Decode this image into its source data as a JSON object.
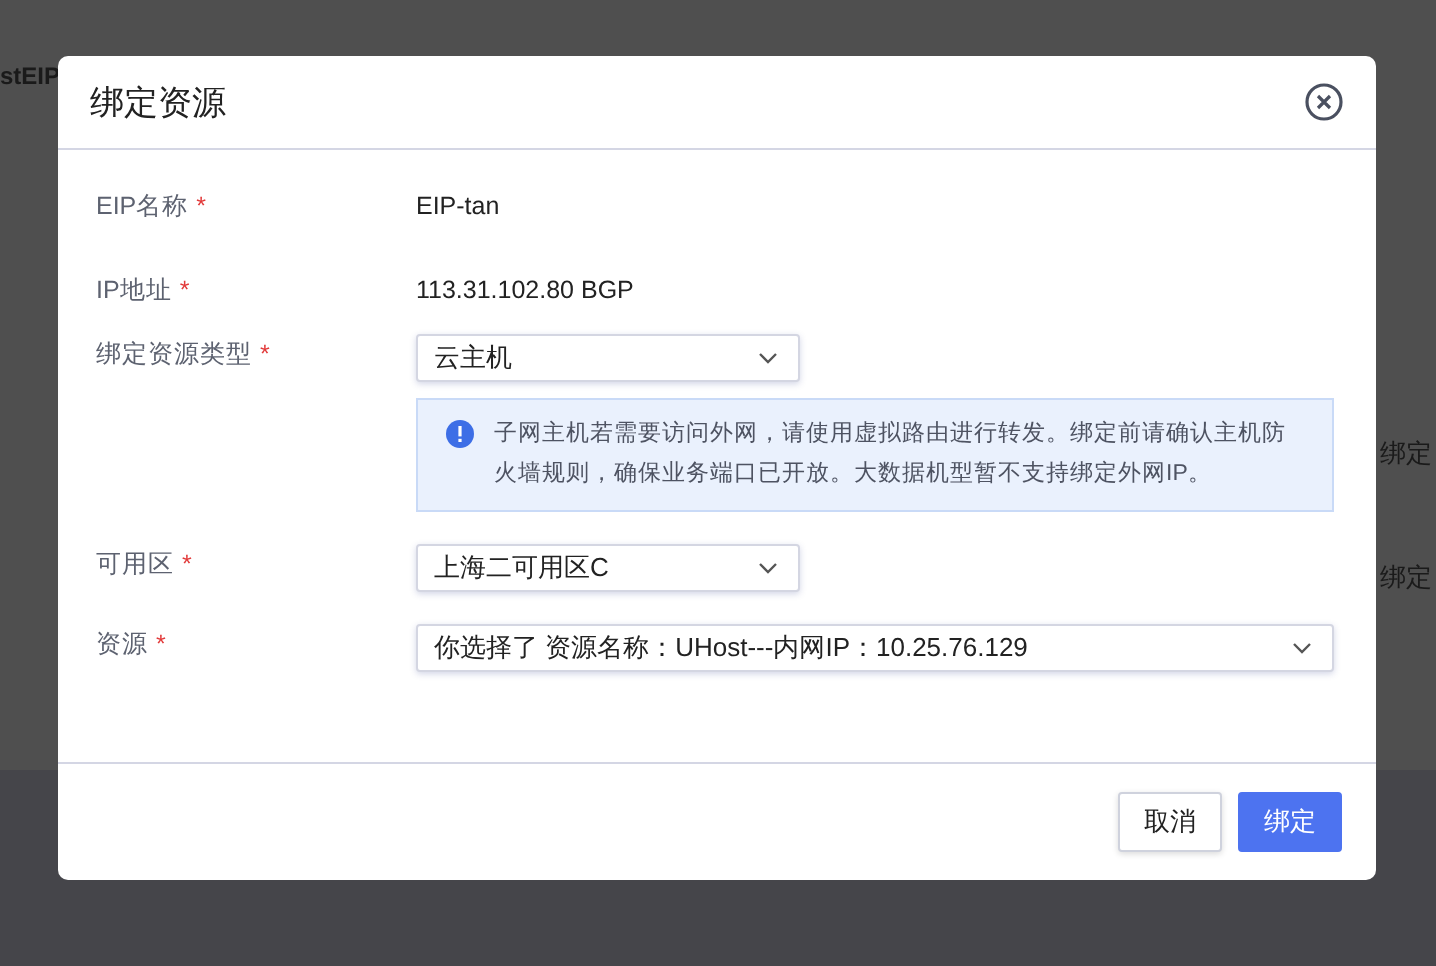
{
  "background_page": {
    "fragments": [
      "stEIP",
      "绑定",
      "绑定"
    ]
  },
  "dialog": {
    "title": "绑定资源",
    "fields": [
      {
        "kind": "text",
        "label": "EIP名称",
        "required": true,
        "required_mark": "*",
        "value": "EIP-tan"
      },
      {
        "kind": "text",
        "label": "IP地址",
        "required": true,
        "required_mark": "*",
        "value": "113.31.102.80 BGP"
      },
      {
        "kind": "select",
        "label": "绑定资源类型",
        "required": true,
        "required_mark": "*",
        "value": "云主机",
        "notice": "子网主机若需要访问外网，请使用虚拟路由进行转发。绑定前请确认主机防火墙规则，确保业务端口已开放。大数据机型暂不支持绑定外网IP。"
      },
      {
        "kind": "select",
        "label": "可用区",
        "required": true,
        "required_mark": "*",
        "value": "上海二可用区C"
      },
      {
        "kind": "wide-select",
        "label": "资源",
        "required": true,
        "required_mark": "*",
        "value": "你选择了 资源名称：UHost---内网IP：10.25.76.129"
      }
    ],
    "buttons": [
      {
        "label": "取消",
        "primary": false
      },
      {
        "label": "绑定",
        "primary": true
      }
    ]
  }
}
